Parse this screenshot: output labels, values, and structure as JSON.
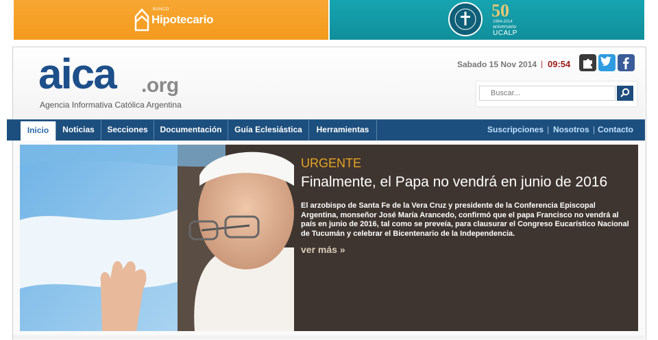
{
  "banners": {
    "left": {
      "small_text": "BANCO",
      "name": "Hipotecario"
    },
    "right": {
      "number": "50",
      "years": "1964-2014",
      "anniversary": "aniversario",
      "name": "UCALP"
    }
  },
  "header": {
    "logo_main": "aica",
    "logo_tld": ".org",
    "subtitle": "Agencia Informativa Católica Argentina",
    "date": "Sabado 15 Nov 2014",
    "separator": "|",
    "time": "09:54"
  },
  "search": {
    "placeholder": "Buscar..."
  },
  "nav": {
    "items": [
      {
        "label": "Inicio"
      },
      {
        "label": "Noticias"
      },
      {
        "label": "Secciones"
      },
      {
        "label": "Documentación"
      },
      {
        "label": "Guía Eclesiástica"
      },
      {
        "label": "Herramientas"
      }
    ],
    "right": [
      {
        "label": "Suscripciones"
      },
      {
        "label": "Nosotros"
      },
      {
        "label": "Contacto"
      }
    ],
    "pipe": "|"
  },
  "hero": {
    "tag": "URGENTE",
    "headline": "Finalmente, el Papa no vendrá en junio de 2016",
    "summary": "El arzobispo de Santa Fe de la Vera Cruz y presidente de la Conferencia Episcopal Argentina, monseñor José María Arancedo, confirmó que el papa Francisco no vendrá al país en junio de 2016, tal como se preveía, para clausurar el Congreso Eucarístico Nacional de Tucumán y celebrar el Bicentenario de la Independencia.",
    "more": "ver más »"
  },
  "colors": {
    "nav": "#1d4f7e",
    "logo": "#1d4f8a",
    "urgent": "#e6a421",
    "time": "#9b1a1a"
  },
  "icons": [
    "shield-icon",
    "seal-icon",
    "puzzle-icon",
    "twitter-icon",
    "facebook-icon",
    "search-icon"
  ]
}
